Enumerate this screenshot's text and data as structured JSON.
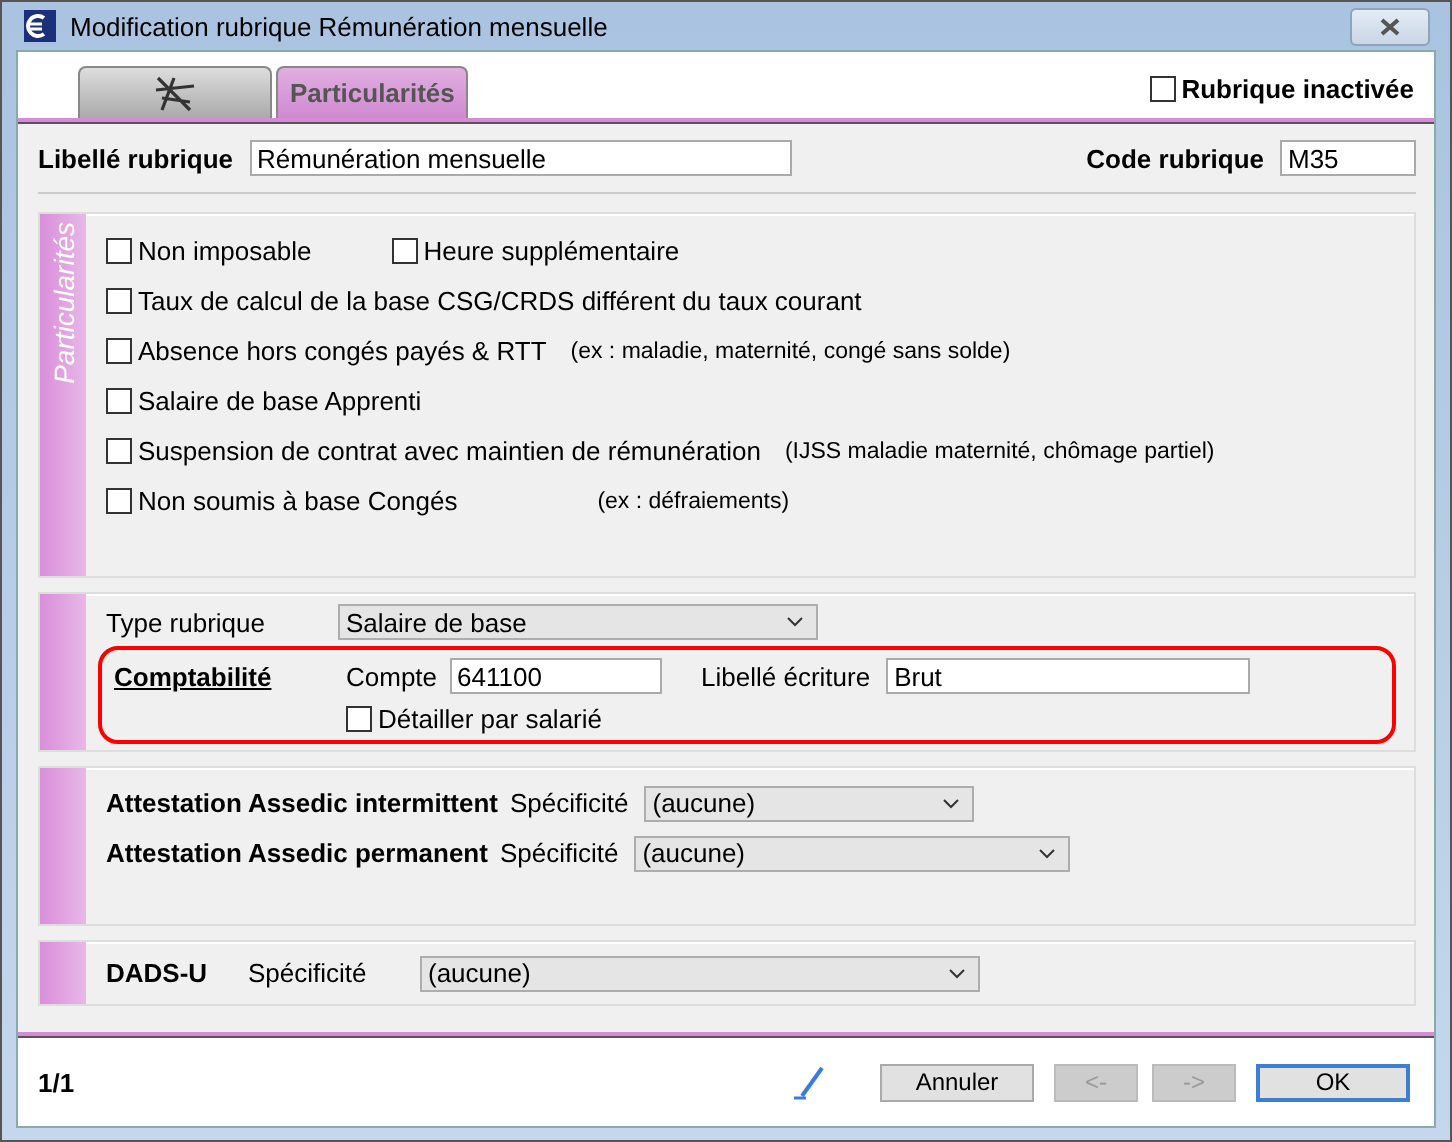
{
  "window": {
    "title": "Modification rubrique Rémunération mensuelle"
  },
  "tabs": [
    {
      "kind": "icon",
      "selected": false
    },
    {
      "kind": "text",
      "label": "Particularités",
      "selected": true
    }
  ],
  "inactive": {
    "label": "Rubrique inactivée",
    "checked": false
  },
  "libelle": {
    "label": "Libellé rubrique",
    "value": "Rémunération mensuelle"
  },
  "code": {
    "label": "Code rubrique",
    "value": "M35"
  },
  "particularites": {
    "title": "Particularités",
    "rows": [
      {
        "items": [
          {
            "label": "Non imposable",
            "checked": false
          },
          {
            "label": "Heure supplémentaire",
            "checked": false
          }
        ]
      },
      {
        "items": [
          {
            "label": "Taux de calcul de la base CSG/CRDS différent du taux courant",
            "checked": false
          }
        ]
      },
      {
        "items": [
          {
            "label": "Absence hors congés payés & RTT",
            "checked": false
          }
        ],
        "note": "(ex : maladie, maternité, congé sans solde)"
      },
      {
        "items": [
          {
            "label": "Salaire de base Apprenti",
            "checked": false
          }
        ]
      },
      {
        "items": [
          {
            "label": "Suspension de contrat avec maintien de rémunération",
            "checked": false
          }
        ],
        "note": "(IJSS maladie maternité, chômage partiel)"
      },
      {
        "items": [
          {
            "label": "Non soumis à base Congés",
            "checked": false
          }
        ],
        "note": "(ex : défraiements)"
      }
    ]
  },
  "type": {
    "label": "Type rubrique",
    "value": "Salaire de base"
  },
  "comptabilite": {
    "label": "Comptabilité",
    "highlighted": true,
    "compte_label": "Compte",
    "compte": "641100",
    "libelle_label": "Libellé écriture",
    "libelle": "Brut",
    "detail": {
      "label": "Détailler par salarié",
      "checked": false
    }
  },
  "assedic": [
    {
      "label": "Attestation Assedic intermittent",
      "spec_label": "Spécificité",
      "value": "(aucune)"
    },
    {
      "label": "Attestation Assedic permanent",
      "spec_label": "Spécificité",
      "value": "(aucune)"
    }
  ],
  "dads": {
    "label": "DADS-U",
    "spec_label": "Spécificité",
    "value": "(aucune)"
  },
  "footer": {
    "page": "1/1",
    "buttons": [
      {
        "label": "Annuler",
        "disabled": false,
        "default": false
      },
      {
        "label": "<-",
        "disabled": true,
        "default": false
      },
      {
        "label": "->",
        "disabled": true,
        "default": false
      },
      {
        "label": "OK",
        "disabled": false,
        "default": true
      }
    ]
  }
}
